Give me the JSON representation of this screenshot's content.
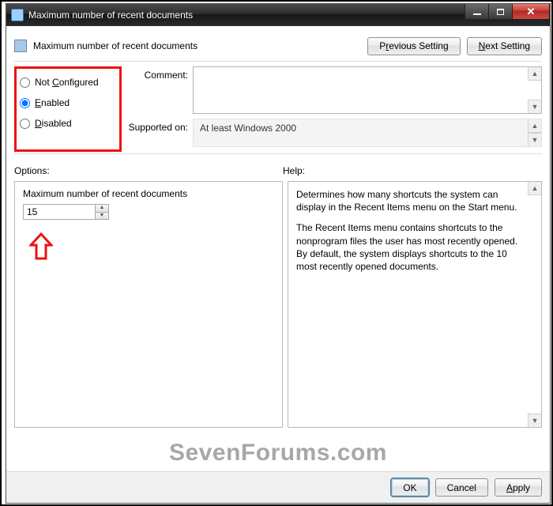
{
  "window": {
    "title": "Maximum number of recent documents"
  },
  "header": {
    "title": "Maximum number of recent documents",
    "prev_btn_pre": "P",
    "prev_btn_u": "r",
    "prev_btn_post": "evious Setting",
    "next_btn_pre": "",
    "next_btn_u": "N",
    "next_btn_post": "ext Setting"
  },
  "radios": {
    "not_configured_pre": "Not ",
    "not_configured_u": "C",
    "not_configured_post": "onfigured",
    "enabled_u": "E",
    "enabled_post": "nabled",
    "disabled_u": "D",
    "disabled_post": "isabled",
    "selected": "enabled"
  },
  "form": {
    "comment_label": "Comment:",
    "comment_value": "",
    "supported_label": "Supported on:",
    "supported_value": "At least Windows 2000"
  },
  "sections": {
    "options_label": "Options:",
    "help_label": "Help:"
  },
  "options": {
    "field_label": "Maximum number of recent documents",
    "value": "15"
  },
  "help": {
    "p1": "Determines how many shortcuts the system can display in the Recent Items menu on the Start menu.",
    "p2": "The Recent Items menu contains shortcuts to the nonprogram files the user has most recently opened. By default, the system displays shortcuts to the 10 most recently opened documents."
  },
  "footer": {
    "ok": "OK",
    "cancel": "Cancel",
    "apply_u": "A",
    "apply_post": "pply"
  },
  "watermark": "SevenForums.com"
}
